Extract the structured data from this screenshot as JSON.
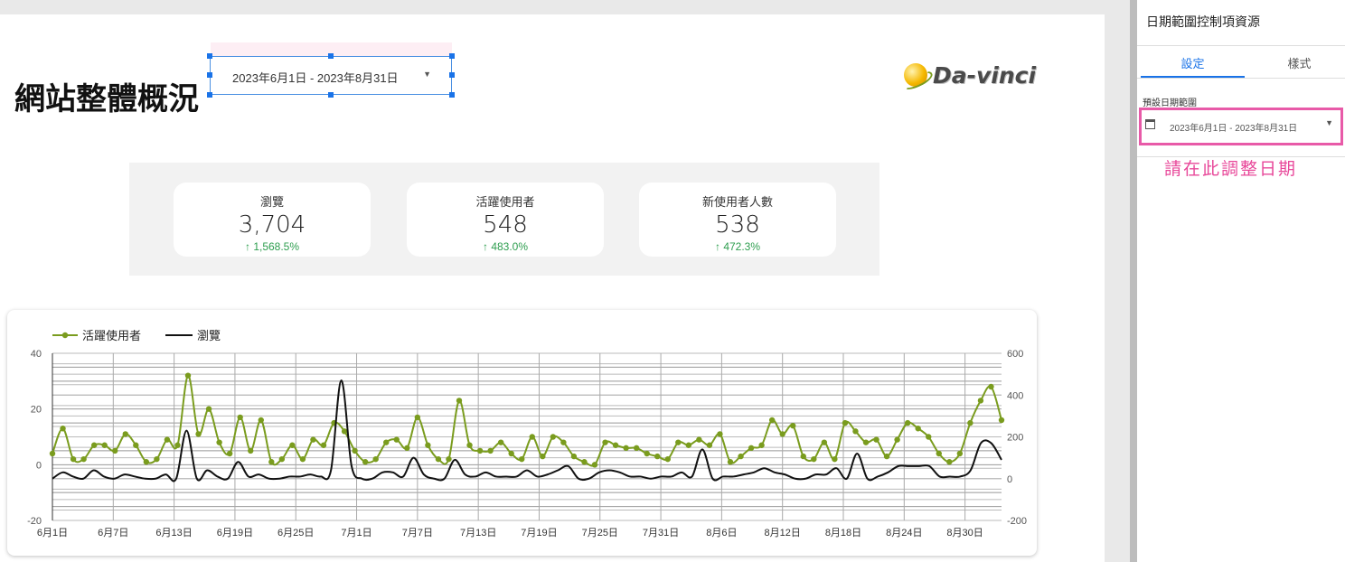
{
  "report": {
    "title": "網站整體概況",
    "date_range": "2023年6月1日 - 2023年8月31日",
    "brand": "Da-vinci"
  },
  "kpis": [
    {
      "label": "瀏覽",
      "value": "3,704",
      "delta": "1,568.5%"
    },
    {
      "label": "活躍使用者",
      "value": "548",
      "delta": "483.0%"
    },
    {
      "label": "新使用者人數",
      "value": "538",
      "delta": "472.3%"
    }
  ],
  "panel": {
    "title": "日期範圍控制項資源",
    "tabs": [
      "設定",
      "樣式"
    ],
    "field_label": "預設日期範圍",
    "field_value": "2023年6月1日 - 2023年8月31日",
    "hint": "請在此調整日期"
  },
  "colors": {
    "active_users": "#7a9c1e",
    "views": "#111111",
    "accent": "#1a73e8",
    "highlight": "#e85aa8"
  },
  "chart_data": {
    "type": "line",
    "x_tick_labels": [
      "6月1日",
      "6月7日",
      "6月13日",
      "6月19日",
      "6月25日",
      "7月1日",
      "7月7日",
      "7月13日",
      "7月19日",
      "7月25日",
      "7月31日",
      "8月6日",
      "8月12日",
      "8月18日",
      "8月24日",
      "8月30日"
    ],
    "y_left_ticks": [
      "40",
      "20",
      "0",
      "-20"
    ],
    "y_right_ticks": [
      "600",
      "400",
      "200",
      "0",
      "-200"
    ],
    "ylim_left": [
      -20,
      40
    ],
    "ylim_right": [
      -200,
      600
    ],
    "grid": true,
    "legend_position": "top-left",
    "series": [
      {
        "name": "活躍使用者",
        "axis": "left",
        "values": [
          4,
          13,
          2,
          2,
          7,
          7,
          5,
          11,
          7,
          1,
          2,
          9,
          7,
          32,
          11,
          20,
          8,
          4,
          17,
          5,
          16,
          1,
          2,
          7,
          2,
          9,
          7,
          15,
          12,
          5,
          1,
          2,
          8,
          9,
          6,
          17,
          7,
          2,
          2,
          23,
          7,
          5,
          5,
          8,
          4,
          2,
          10,
          3,
          10,
          8,
          3,
          1,
          0,
          8,
          7,
          6,
          6,
          4,
          3,
          2,
          8,
          7,
          9,
          7,
          11,
          1,
          3,
          6,
          7,
          16,
          11,
          14,
          3,
          2,
          8,
          2,
          15,
          12,
          8,
          9,
          3,
          9,
          15,
          13,
          10,
          4,
          1,
          4,
          15,
          23,
          28,
          16
        ]
      },
      {
        "name": "瀏覽",
        "axis": "right",
        "values": [
          0,
          30,
          10,
          0,
          40,
          10,
          0,
          20,
          10,
          0,
          0,
          20,
          0,
          230,
          0,
          40,
          10,
          0,
          80,
          10,
          20,
          0,
          0,
          10,
          10,
          20,
          10,
          40,
          470,
          60,
          0,
          0,
          30,
          30,
          10,
          100,
          20,
          0,
          0,
          90,
          20,
          10,
          30,
          10,
          10,
          10,
          40,
          10,
          20,
          40,
          60,
          0,
          0,
          30,
          40,
          30,
          10,
          10,
          0,
          10,
          10,
          30,
          10,
          140,
          0,
          10,
          10,
          20,
          30,
          50,
          30,
          20,
          0,
          0,
          20,
          20,
          50,
          0,
          120,
          0,
          10,
          30,
          60,
          60,
          60,
          60,
          10,
          10,
          10,
          40,
          170,
          170,
          90
        ]
      }
    ]
  }
}
